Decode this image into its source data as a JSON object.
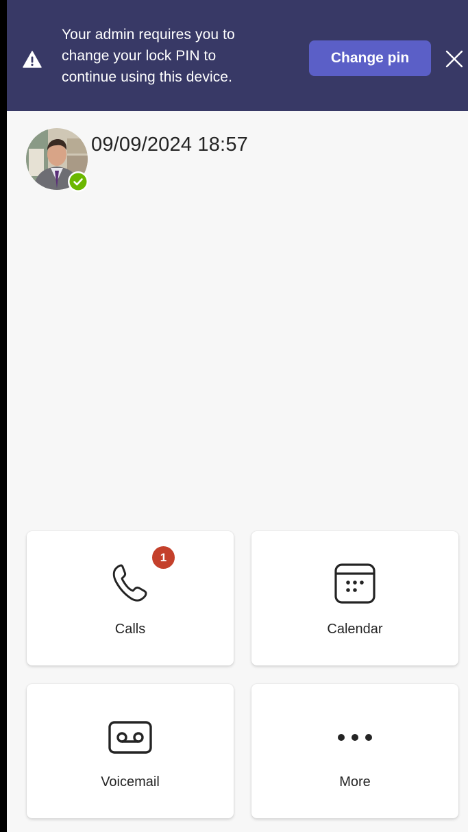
{
  "banner": {
    "message_lines": [
      "Your admin requires you to",
      "change your lock PIN to",
      "continue using this device."
    ],
    "icon": "warning-icon",
    "change_pin_label": "Change pin",
    "close_icon": "close-icon"
  },
  "profile": {
    "datetime": "09/09/2024 18:57",
    "presence": "available",
    "presence_color": "#6bb700"
  },
  "tiles": [
    {
      "label": "Calls",
      "icon": "phone-icon",
      "badge": "1"
    },
    {
      "label": "Calendar",
      "icon": "calendar-icon"
    },
    {
      "label": "Voicemail",
      "icon": "voicemail-icon"
    },
    {
      "label": "More",
      "icon": "more-icon"
    }
  ],
  "colors": {
    "banner_bg": "#383966",
    "accent": "#5b5fc7",
    "badge": "#c4402b"
  }
}
